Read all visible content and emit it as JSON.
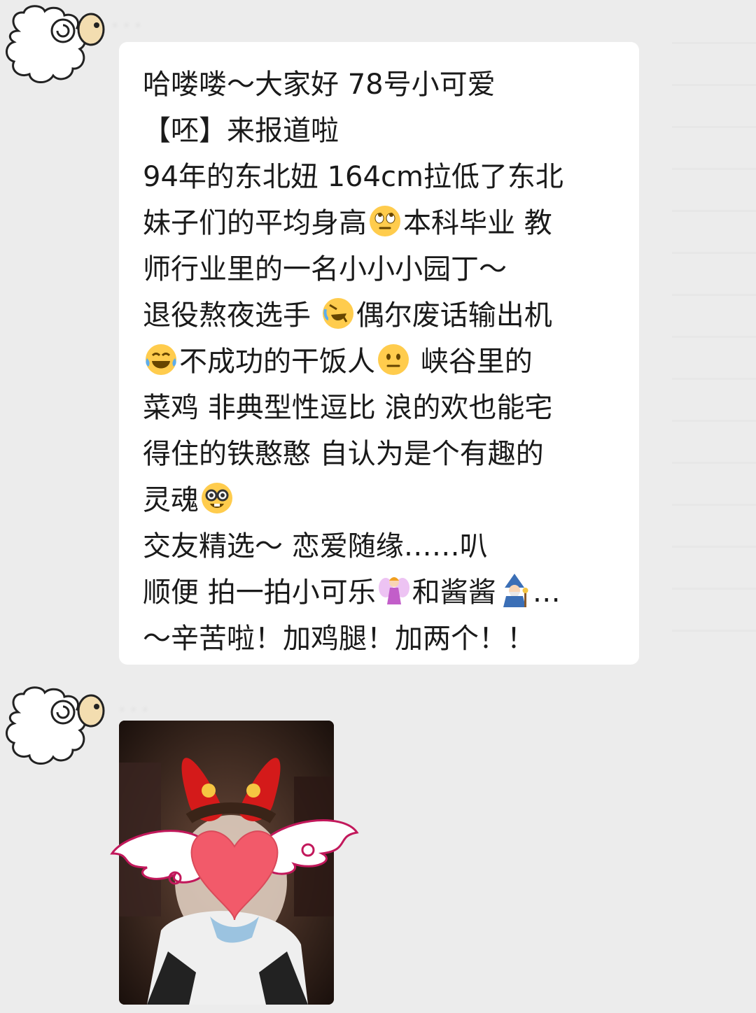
{
  "colors": {
    "background": "#ececec",
    "bubble": "#ffffff",
    "text": "#1a1a1a"
  },
  "messages": [
    {
      "type": "text",
      "avatar_icon": "sheep-avatar-icon",
      "lines": [
        {
          "text": "哈喽喽～大家好 78号小可爱"
        },
        {
          "text": "【呸】来报道啦"
        },
        {
          "text": "94年的东北妞 164cm拉低了东北"
        },
        {
          "pre": "妹子们的平均身高",
          "emoji": "rolling-eyes-emoji-icon",
          "post": "本科毕业 教"
        },
        {
          "text": "师行业里的一名小小小园丁～"
        },
        {
          "pre": "退役熬夜选手 ",
          "emoji": "rofl-emoji-icon",
          "post": "偶尔废话输出机"
        },
        {
          "pre": "",
          "emoji": "tears-of-joy-emoji-icon",
          "post": "不成功的干饭人",
          "emoji2": "neutral-face-emoji-icon",
          "post2": " 峡谷里的"
        },
        {
          "text": "菜鸡  非典型性逗比 浪的欢也能宅"
        },
        {
          "text": "得住的铁憨憨 自认为是个有趣的"
        },
        {
          "pre": "灵魂",
          "emoji": "nerd-face-emoji-icon",
          "post": ""
        },
        {
          "text": "交友精选～ 恋爱随缘……叭"
        },
        {
          "pre": "顺便 拍一拍小可乐",
          "emoji": "fairy-emoji-icon",
          "post": "和酱酱",
          "emoji2": "mage-emoji-icon",
          "post2": "…"
        },
        {
          "text": "～辛苦啦！加鸡腿！加两个！！"
        }
      ]
    },
    {
      "type": "image",
      "avatar_icon": "sheep-avatar-icon",
      "image_icon": "photo-red-bow-headband-with-heart-sticker"
    }
  ]
}
